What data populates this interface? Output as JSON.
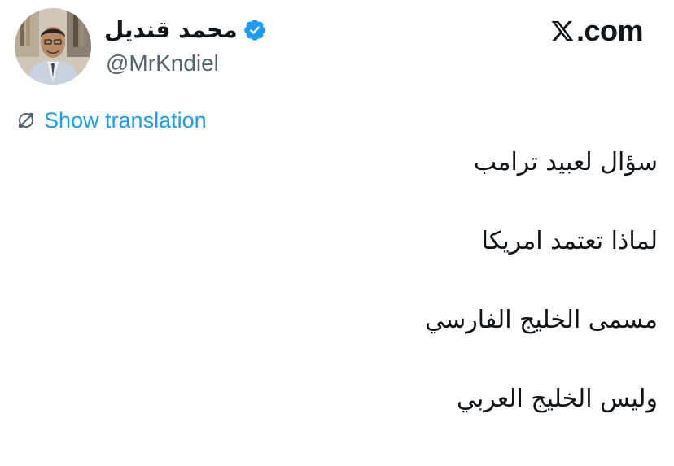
{
  "author": {
    "display_name": "محمد قنديل",
    "handle": "@MrKndiel",
    "verified": true,
    "avatar_icon": "user-avatar-photo"
  },
  "brand": {
    "logo_icon": "x-logo-icon",
    "text": ".com"
  },
  "translation": {
    "icon": "translate-icon",
    "label": "Show translation"
  },
  "tweet": {
    "lines": [
      "سؤال لعبيد ترامب",
      "لماذا تعتمد امريكا",
      "مسمى الخليج الفارسي",
      "وليس الخليج العربي"
    ]
  },
  "colors": {
    "text": "#0f1419",
    "secondary": "#536471",
    "link": "#1d9bf0",
    "verified": "#1d9bf0"
  }
}
